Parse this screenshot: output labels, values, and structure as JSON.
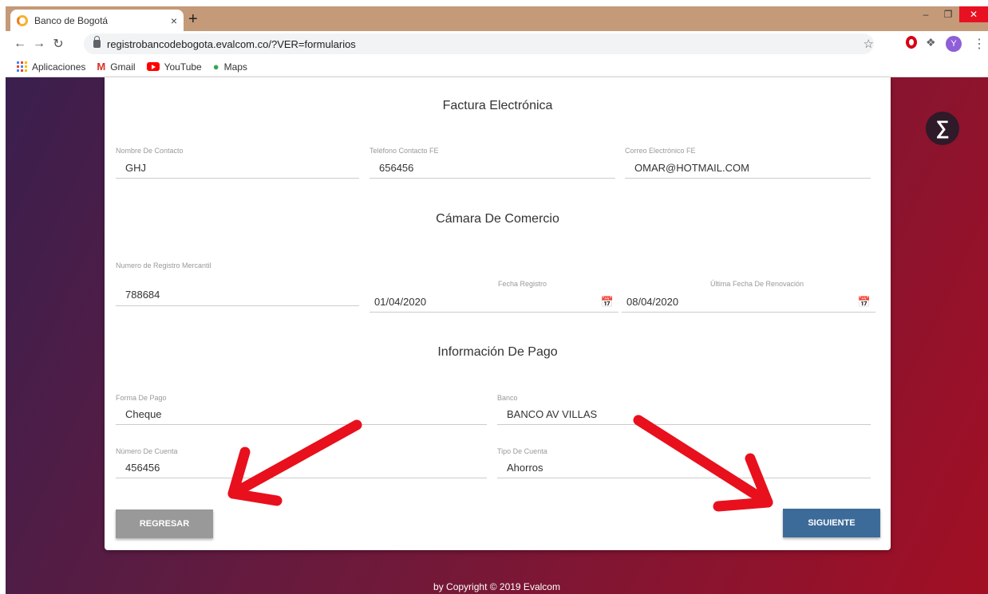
{
  "browser": {
    "tab_title": "Banco de Bogotá",
    "tab_close": "×",
    "new_tab": "+",
    "url": "registrobancodebogota.evalcom.co/?VER=formularios",
    "avatar_letter": "Y",
    "bookmarks": [
      "Aplicaciones",
      "Gmail",
      "YouTube",
      "Maps"
    ]
  },
  "sections": {
    "factura": "Factura Electrónica",
    "camara": "Cámara De Comercio",
    "pago": "Información De Pago"
  },
  "factura": {
    "contacto_label": "Nombre De Contacto",
    "contacto_value": "GHJ",
    "telefono_label": "Teléfono Contacto FE",
    "telefono_value": "656456",
    "correo_label": "Correo Electrónico FE",
    "correo_value": "OMAR@HOTMAIL.COM"
  },
  "camara": {
    "registro_label": "Numero de Registro Mercantil",
    "registro_value": "788684",
    "fecha_label": "Fecha Registro",
    "fecha_value": "01/04/2020",
    "renovacion_label": "Última Fecha De Renovación",
    "renovacion_value": "08/04/2020"
  },
  "pago": {
    "forma_label": "Forma De Pago",
    "forma_value": "Cheque",
    "banco_label": "Banco",
    "banco_value": "BANCO AV VILLAS",
    "cuenta_label": "Número De Cuenta",
    "cuenta_value": "456456",
    "tipo_label": "Tipo De Cuenta",
    "tipo_value": "Ahorros"
  },
  "buttons": {
    "back": "REGRESAR",
    "next": "SIGUIENTE"
  },
  "footer": "by Copyright © 2019 Evalcom",
  "colors": {
    "button_next": "#3d6b99",
    "button_back": "#999999",
    "annotation_arrow": "#e8101c"
  }
}
